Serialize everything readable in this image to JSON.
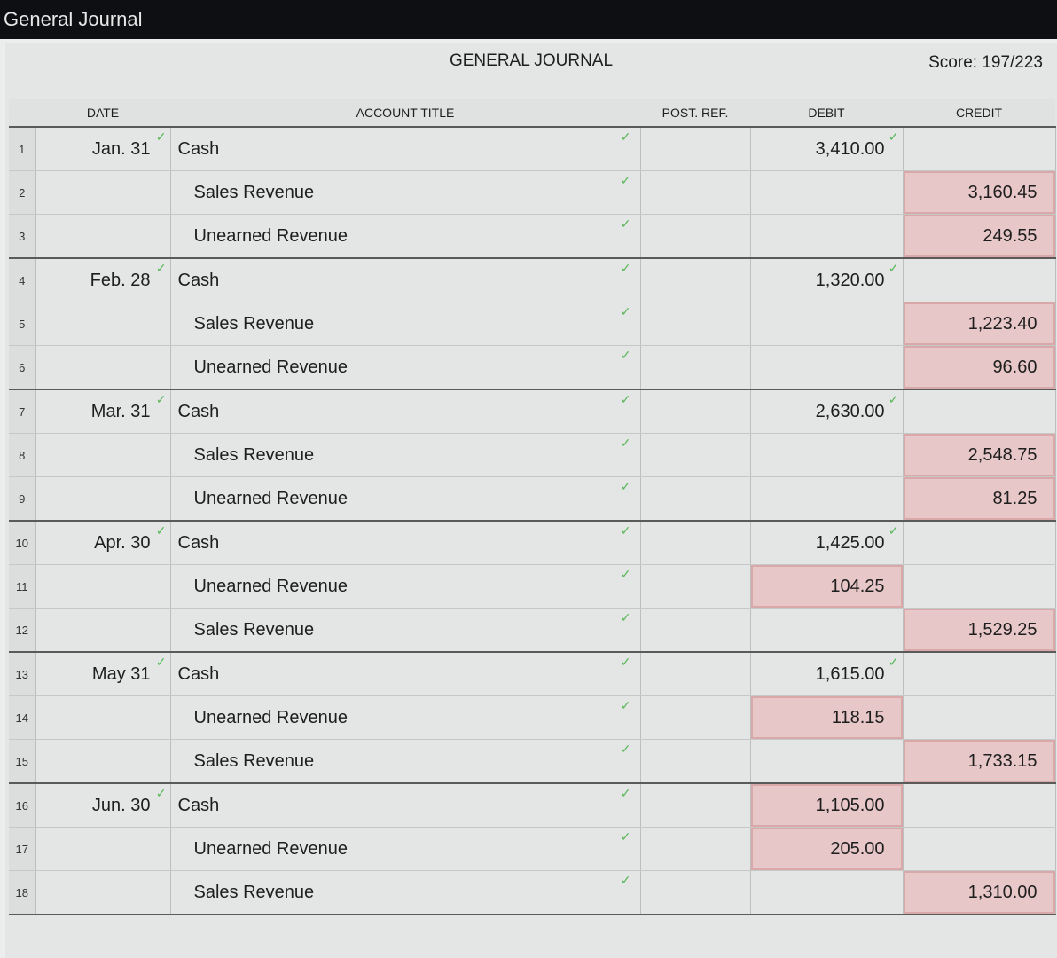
{
  "window_title": "General Journal",
  "heading": "GENERAL JOURNAL",
  "score": "Score: 197/223",
  "columns": {
    "date": "DATE",
    "account": "ACCOUNT TITLE",
    "post_ref": "POST. REF.",
    "debit": "DEBIT",
    "credit": "CREDIT"
  },
  "colors": {
    "error_fill": "#e7c7c7",
    "check": "#5bb85b"
  },
  "rows": [
    {
      "num": "1",
      "date": "Jan. 31",
      "account": "Cash",
      "debit": "3,410.00",
      "credit": ""
    },
    {
      "num": "2",
      "date": "",
      "account": "Sales Revenue",
      "debit": "",
      "credit": "3,160.45"
    },
    {
      "num": "3",
      "date": "",
      "account": "Unearned Revenue",
      "debit": "",
      "credit": "249.55"
    },
    {
      "num": "4",
      "date": "Feb. 28",
      "account": "Cash",
      "debit": "1,320.00",
      "credit": ""
    },
    {
      "num": "5",
      "date": "",
      "account": "Sales Revenue",
      "debit": "",
      "credit": "1,223.40"
    },
    {
      "num": "6",
      "date": "",
      "account": "Unearned Revenue",
      "debit": "",
      "credit": "96.60"
    },
    {
      "num": "7",
      "date": "Mar. 31",
      "account": "Cash",
      "debit": "2,630.00",
      "credit": ""
    },
    {
      "num": "8",
      "date": "",
      "account": "Sales Revenue",
      "debit": "",
      "credit": "2,548.75"
    },
    {
      "num": "9",
      "date": "",
      "account": "Unearned Revenue",
      "debit": "",
      "credit": "81.25"
    },
    {
      "num": "10",
      "date": "Apr. 30",
      "account": "Cash",
      "debit": "1,425.00",
      "credit": ""
    },
    {
      "num": "11",
      "date": "",
      "account": "Unearned Revenue",
      "debit": "104.25",
      "credit": ""
    },
    {
      "num": "12",
      "date": "",
      "account": "Sales Revenue",
      "debit": "",
      "credit": "1,529.25"
    },
    {
      "num": "13",
      "date": "May 31",
      "account": "Cash",
      "debit": "1,615.00",
      "credit": ""
    },
    {
      "num": "14",
      "date": "",
      "account": "Unearned Revenue",
      "debit": "118.15",
      "credit": ""
    },
    {
      "num": "15",
      "date": "",
      "account": "Sales Revenue",
      "debit": "",
      "credit": "1,733.15"
    },
    {
      "num": "16",
      "date": "Jun. 30",
      "account": "Cash",
      "debit": "1,105.00",
      "credit": ""
    },
    {
      "num": "17",
      "date": "",
      "account": "Unearned Revenue",
      "debit": "205.00",
      "credit": ""
    },
    {
      "num": "18",
      "date": "",
      "account": "Sales Revenue",
      "debit": "",
      "credit": "1,310.00"
    }
  ]
}
